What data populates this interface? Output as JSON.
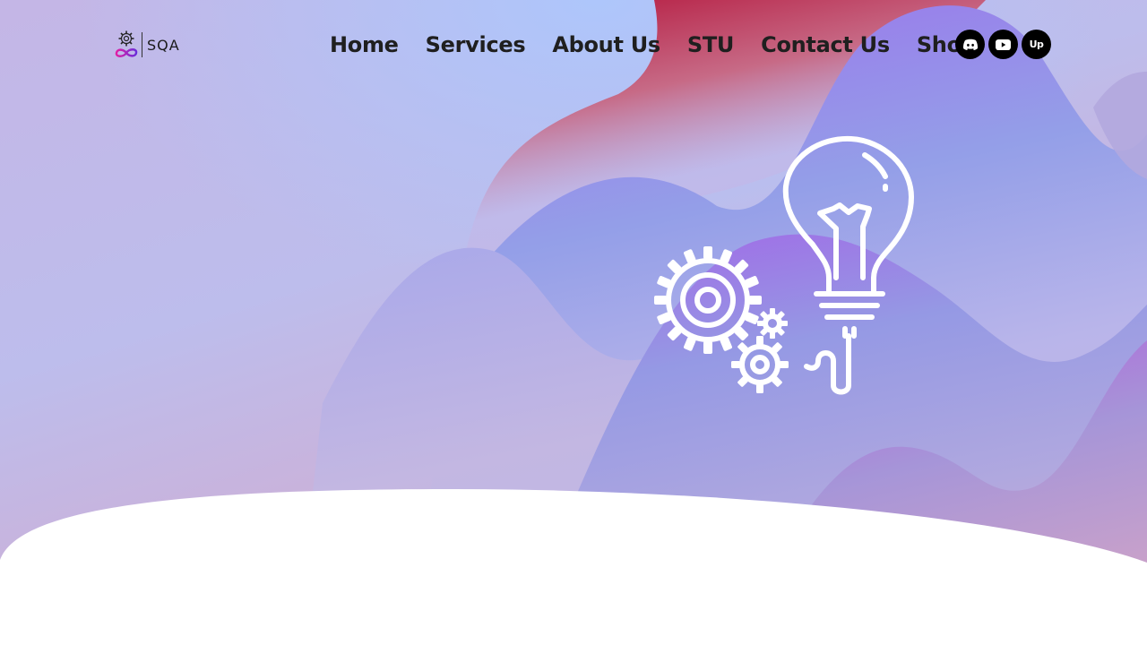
{
  "brand": {
    "logo_text": "SQA",
    "logo_icon": "gear-infinity-icon"
  },
  "nav": {
    "items": [
      {
        "label": "Home"
      },
      {
        "label": "Services"
      },
      {
        "label": "About Us"
      },
      {
        "label": "STU"
      },
      {
        "label": "Contact Us"
      },
      {
        "label": "Shop"
      }
    ]
  },
  "socials": [
    {
      "name": "discord",
      "icon": "discord-icon"
    },
    {
      "name": "youtube",
      "icon": "youtube-icon"
    },
    {
      "name": "upwork",
      "icon": "upwork-icon",
      "label": "Up"
    }
  ],
  "hero": {
    "illustration": "lightbulb-gears-icon"
  },
  "colors": {
    "nav_text": "#1f1f1f",
    "social_bg": "#000000",
    "bg_lavender": "#c3b9e6",
    "bg_pink": "#d7a6c8",
    "wave_purple": "#9b78ea",
    "wave_red": "#b8264a",
    "illustration": "#ffffff"
  }
}
